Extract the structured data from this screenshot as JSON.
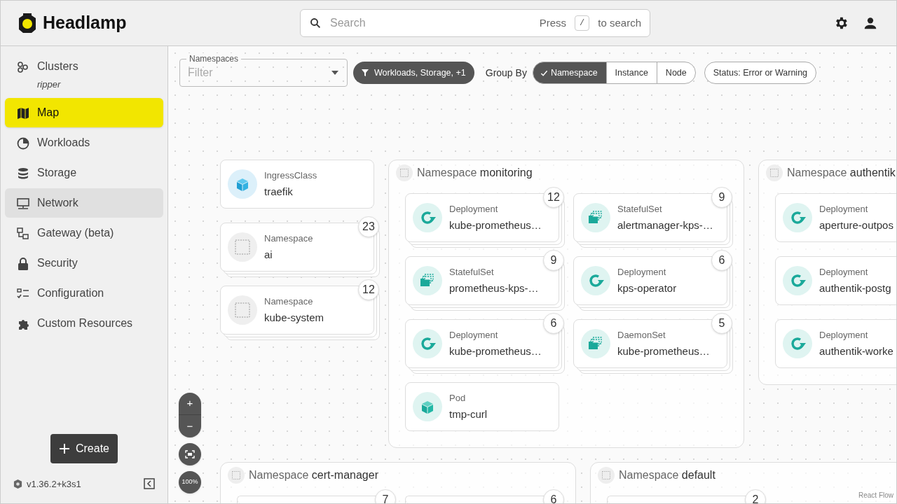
{
  "header": {
    "title": "Headlamp",
    "search": {
      "placeholder": "Search",
      "hint_prefix": "Press",
      "hint_key": "/",
      "hint_suffix": "to search"
    }
  },
  "sidebar": {
    "items": [
      {
        "label": "Clusters",
        "sub": "ripper",
        "selected": false,
        "highlighted": false
      },
      {
        "label": "Map",
        "selected": true,
        "highlighted": false
      },
      {
        "label": "Workloads",
        "selected": false,
        "highlighted": false
      },
      {
        "label": "Storage",
        "selected": false,
        "highlighted": false
      },
      {
        "label": "Network",
        "selected": false,
        "highlighted": true
      },
      {
        "label": "Gateway (beta)",
        "selected": false,
        "highlighted": false
      },
      {
        "label": "Security",
        "selected": false,
        "highlighted": false
      },
      {
        "label": "Configuration",
        "selected": false,
        "highlighted": false
      },
      {
        "label": "Custom Resources",
        "selected": false,
        "highlighted": false
      }
    ],
    "create_button": "Create",
    "version": "v1.36.2+k3s1"
  },
  "toolbar": {
    "namespaces": {
      "label": "Namespaces",
      "placeholder": "Filter"
    },
    "filter_chip": "Workloads, Storage, +1",
    "group_by": {
      "label": "Group By",
      "options": [
        {
          "label": "Namespace",
          "selected": true
        },
        {
          "label": "Instance",
          "selected": false
        },
        {
          "label": "Node",
          "selected": false
        }
      ]
    },
    "status_chip": "Status: Error or Warning"
  },
  "map": {
    "nodes": [
      {
        "kind": "ingressclass",
        "type": "IngressClass",
        "name": "traefik"
      },
      {
        "kind": "namespace",
        "type": "Namespace",
        "name": "ai",
        "count": "23"
      },
      {
        "kind": "namespace",
        "type": "Namespace",
        "name": "kube-system",
        "count": "12"
      }
    ],
    "groups": [
      {
        "prefix": "Namespace",
        "name": "monitoring",
        "nodes": [
          {
            "kind": "deployment",
            "type": "Deployment",
            "name": "kube-prometheus…",
            "count": "12"
          },
          {
            "kind": "set",
            "type": "StatefulSet",
            "name": "alertmanager-kps-…",
            "count": "9"
          },
          {
            "kind": "set",
            "type": "StatefulSet",
            "name": "prometheus-kps-…",
            "count": "9"
          },
          {
            "kind": "deployment",
            "type": "Deployment",
            "name": "kps-operator",
            "count": "6"
          },
          {
            "kind": "deployment",
            "type": "Deployment",
            "name": "kube-prometheus…",
            "count": "6"
          },
          {
            "kind": "set",
            "type": "DaemonSet",
            "name": "kube-prometheus…",
            "count": "5"
          },
          {
            "kind": "pod",
            "type": "Pod",
            "name": "tmp-curl"
          }
        ]
      },
      {
        "prefix": "Namespace",
        "name": "authentik",
        "nodes": [
          {
            "kind": "deployment",
            "type": "Deployment",
            "name": "aperture-outpos"
          },
          {
            "kind": "deployment",
            "type": "Deployment",
            "name": "authentik-postg"
          },
          {
            "kind": "deployment",
            "type": "Deployment",
            "name": "authentik-worke"
          }
        ]
      },
      {
        "prefix": "Namespace",
        "name": "cert-manager",
        "nodes": [
          {
            "count": "7"
          },
          {
            "count": "6"
          }
        ]
      },
      {
        "prefix": "Namespace",
        "name": "default",
        "nodes": [
          {
            "count": "2"
          }
        ]
      }
    ],
    "zoom_controls": {
      "in": "+",
      "out": "−",
      "reset": "100%"
    },
    "attribution": "React Flow"
  }
}
